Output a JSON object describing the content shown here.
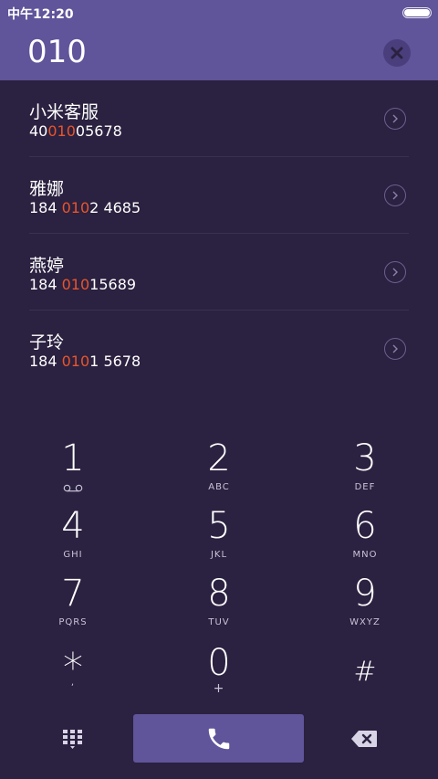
{
  "status_bar": {
    "time": "中午12:20"
  },
  "dialer": {
    "number": "010"
  },
  "suggestions": [
    {
      "name": "小米客服",
      "number_pre": "40",
      "number_match": "010",
      "number_post": "05678"
    },
    {
      "name": "雅娜",
      "number_pre": "184 ",
      "number_match": "010",
      "number_post": "2 4685"
    },
    {
      "name": "燕婷",
      "number_pre": "184 ",
      "number_match": "010",
      "number_post": "15689"
    },
    {
      "name": "子玲",
      "number_pre": "184 ",
      "number_match": "010",
      "number_post": "1 5678"
    }
  ],
  "keypad": [
    {
      "digit": "1",
      "letters": ""
    },
    {
      "digit": "2",
      "letters": "ABC"
    },
    {
      "digit": "3",
      "letters": "DEF"
    },
    {
      "digit": "4",
      "letters": "GHI"
    },
    {
      "digit": "5",
      "letters": "JKL"
    },
    {
      "digit": "6",
      "letters": "MNO"
    },
    {
      "digit": "7",
      "letters": "PQRS"
    },
    {
      "digit": "8",
      "letters": "TUV"
    },
    {
      "digit": "9",
      "letters": "WXYZ"
    },
    {
      "digit": "*",
      "letters": ","
    },
    {
      "digit": "0",
      "letters": "+"
    },
    {
      "digit": "#",
      "letters": ""
    }
  ],
  "colors": {
    "accent": "#60549a",
    "background": "#2b2140",
    "match_highlight": "#e8552c"
  },
  "icons": {
    "voicemail": "voicemail-icon",
    "clear": "close-icon",
    "detail": "chevron-right-icon",
    "keypad_toggle": "keypad-grid-icon",
    "call": "phone-icon",
    "backspace": "backspace-icon",
    "battery": "battery-icon"
  }
}
